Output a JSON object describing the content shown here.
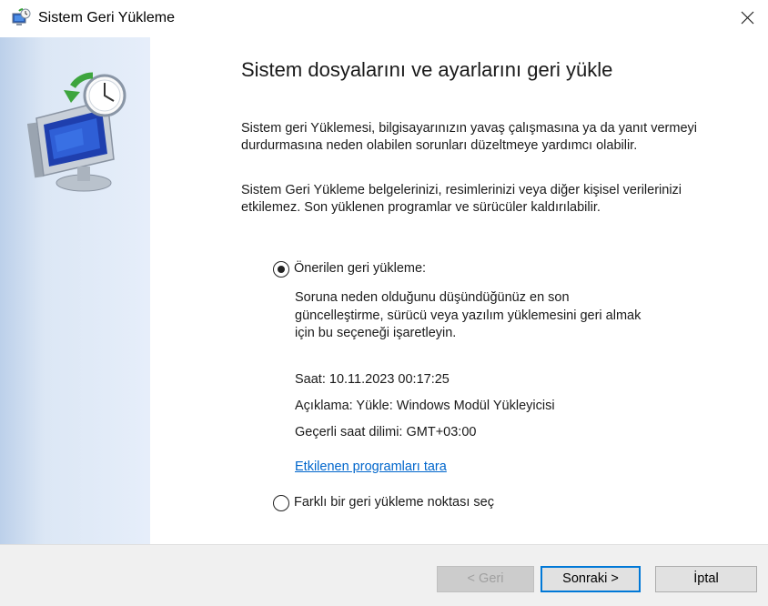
{
  "window": {
    "title": "Sistem Geri Yükleme"
  },
  "icons": {
    "app": "system-restore-icon",
    "close": "close-icon",
    "hero": "system-restore-monitor-clock-icon"
  },
  "content": {
    "heading": "Sistem dosyalarını ve ayarlarını geri yükle",
    "paragraph1": "Sistem geri Yüklemesi, bilgisayarınızın yavaş çalışmasına ya da yanıt vermeyi durdurmasına neden olabilen sorunları düzeltmeye yardımcı olabilir.",
    "paragraph2": "Sistem Geri Yükleme belgelerinizi, resimlerinizi veya diğer kişisel verilerinizi etkilemez. Son yüklenen programlar ve sürücüler kaldırılabilir.",
    "option_recommended": {
      "label": "Önerilen geri yükleme:",
      "selected": true,
      "description": "Soruna neden olduğunu düşündüğünüz en son güncelleştirme, sürücü veya yazılım yüklemesini geri almak için bu seçeneği işaretleyin.",
      "time": "Saat: 10.11.2023 00:17:25",
      "description_line": "Açıklama: Yükle: Windows Modül Yükleyicisi",
      "timezone": "Geçerli saat dilimi: GMT+03:00",
      "scan_link": "Etkilenen programları tara"
    },
    "option_other": {
      "label": "Farklı bir geri yükleme noktası seç",
      "selected": false
    }
  },
  "footer": {
    "back_label": "< Geri",
    "back_enabled": false,
    "next_label": "Sonraki >",
    "cancel_label": "İptal"
  },
  "colors": {
    "accent": "#0078d7",
    "link": "#0066cc",
    "sidebar": "#dce7f5",
    "footer": "#f0f0f0"
  }
}
